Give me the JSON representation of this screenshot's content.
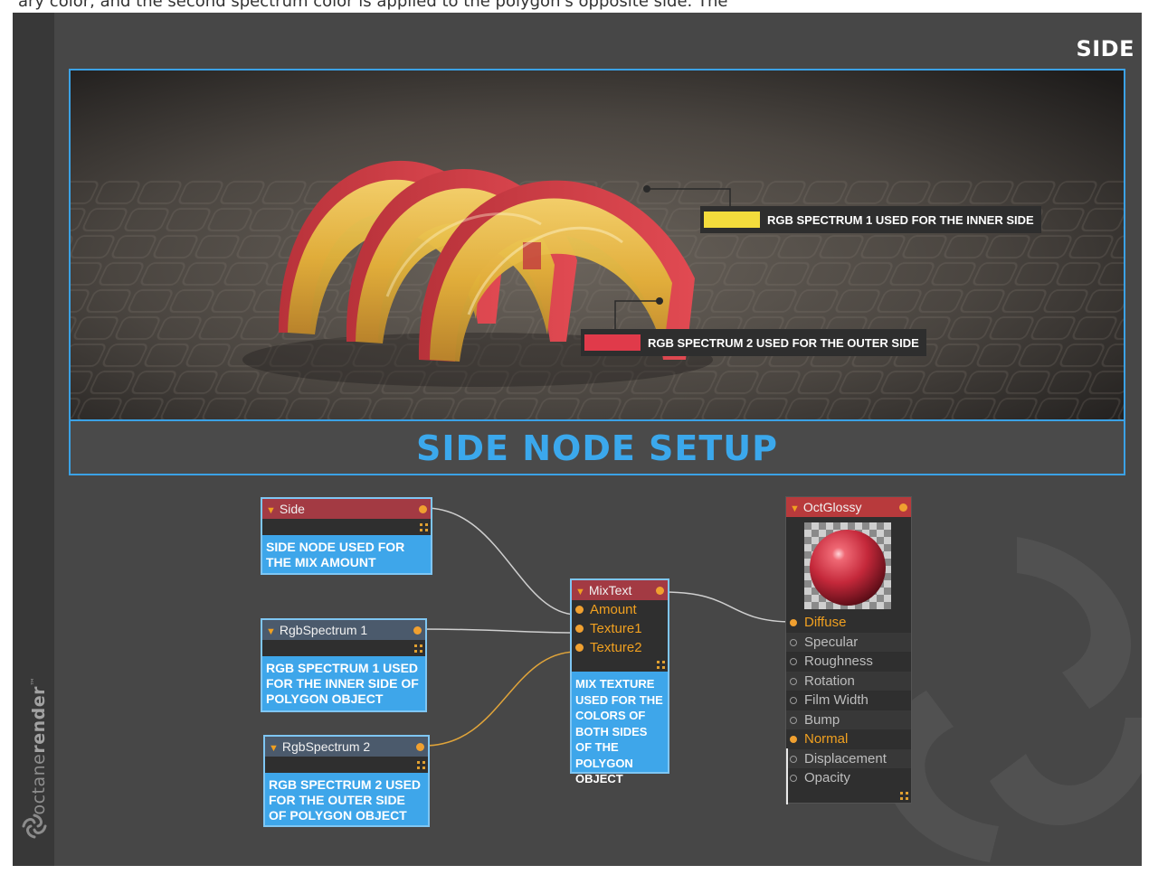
{
  "top_fragment": "ary color, and the second spectrum color is applied to the polygon's opposite side. The",
  "section_title": "SIDE",
  "render": {
    "callout_inner": "RGB SPECTRUM 1 USED FOR THE INNER SIDE",
    "callout_outer": "RGB SPECTRUM 2 USED FOR THE OUTER SIDE"
  },
  "setup_title": "SIDE NODE SETUP",
  "nodes": {
    "side": {
      "title": "Side",
      "desc": "SIDE NODE USED FOR THE MIX AMOUNT"
    },
    "rgb1": {
      "title": "RgbSpectrum 1",
      "desc": "RGB SPECTRUM 1 USED FOR THE INNER SIDE OF POLYGON OBJECT"
    },
    "rgb2": {
      "title": "RgbSpectrum 2",
      "desc": "RGB SPECTRUM 2 USED FOR THE OUTER SIDE OF POLYGON OBJECT"
    },
    "mix": {
      "title": "MixText",
      "inputs": [
        "Amount",
        "Texture1",
        "Texture2"
      ],
      "desc": "MIX TEXTURE USED FOR THE COLORS OF BOTH SIDES OF THE POLYGON OBJECT"
    },
    "glossy": {
      "title": "OctGlossy",
      "params": [
        "Diffuse",
        "Specular",
        "Roughness",
        "Rotation",
        "Film Width",
        "Bump",
        "Normal",
        "Displacement",
        "Opacity"
      ]
    }
  },
  "brand": {
    "light": "octane",
    "bold": "render",
    "tm": "™"
  },
  "colors": {
    "accent_blue": "#3ba2e6",
    "inner_yellow": "#f4dc3c",
    "outer_red": "#e03a4a",
    "port_orange": "#f0a030"
  }
}
